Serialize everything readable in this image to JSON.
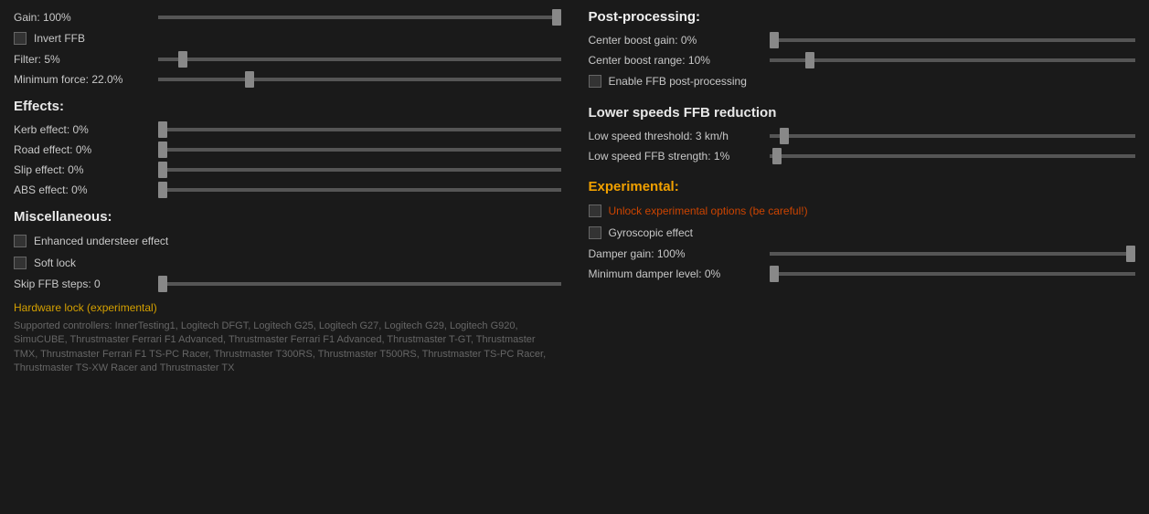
{
  "left": {
    "gain_label": "Gain: 100%",
    "gain_value": 100,
    "invert_ffb_label": "Invert FFB",
    "filter_label": "Filter: 5%",
    "filter_value": 5,
    "minimum_force_label": "Minimum force: 22.0%",
    "minimum_force_value": 22,
    "effects_title": "Effects:",
    "kerb_label": "Kerb effect: 0%",
    "kerb_value": 0,
    "road_label": "Road effect: 0%",
    "road_value": 0,
    "slip_label": "Slip effect: 0%",
    "slip_value": 0,
    "abs_label": "ABS effect: 0%",
    "abs_value": 0,
    "miscellaneous_title": "Miscellaneous:",
    "enhanced_understeer_label": "Enhanced understeer effect",
    "soft_lock_label": "Soft lock",
    "skip_ffb_label": "Skip FFB steps: 0",
    "skip_ffb_value": 0,
    "hardware_lock_label": "Hardware lock (experimental)",
    "supported_controllers_label": "Supported controllers: InnerTesting1, Logitech DFGT, Logitech G25, Logitech G27, Logitech G29, Logitech G920, SimuCUBE, Thrustmaster Ferrari F1 Advanced, Thrustmaster Ferrari F1 Advanced, Thrustmaster T-GT, Thrustmaster TMX, Thrustmaster Ferrari F1 TS-PC Racer, Thrustmaster T300RS, Thrustmaster T500RS, Thrustmaster TS-PC Racer, Thrustmaster TS-XW Racer and Thrustmaster TX"
  },
  "right": {
    "post_processing_title": "Post-processing:",
    "center_boost_gain_label": "Center boost gain: 0%",
    "center_boost_gain_value": 0,
    "center_boost_range_label": "Center boost range: 10%",
    "center_boost_range_value": 10,
    "enable_ffb_label": "Enable FFB post-processing",
    "lower_speeds_title": "Lower speeds FFB reduction",
    "low_speed_threshold_label": "Low speed threshold: 3 km/h",
    "low_speed_threshold_value": 3,
    "low_speed_ffb_label": "Low speed FFB strength: 1%",
    "low_speed_ffb_value": 1,
    "experimental_title": "Experimental:",
    "unlock_experimental_label": "Unlock experimental options (be careful!)",
    "gyroscopic_label": "Gyroscopic effect",
    "damper_gain_label": "Damper gain: 100%",
    "damper_gain_value": 100,
    "minimum_damper_label": "Minimum damper level: 0%",
    "minimum_damper_value": 0
  }
}
